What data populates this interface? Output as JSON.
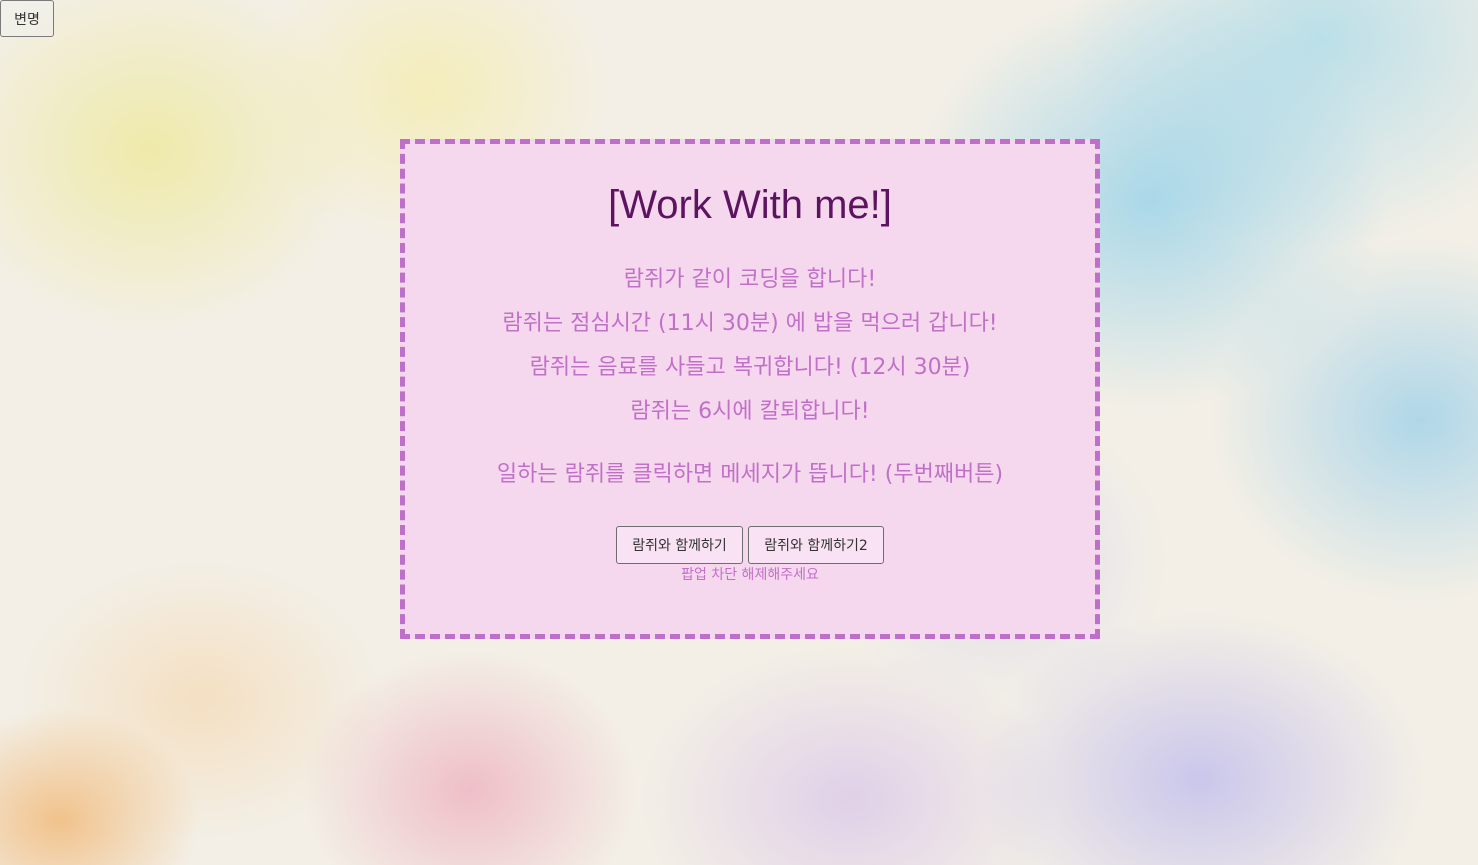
{
  "top_button": {
    "label": "변명"
  },
  "card": {
    "title": "[Work With me!]",
    "lines": [
      "람쥐가 같이 코딩을 합니다!",
      "람쥐는 점심시간 (11시 30분) 에 밥을 먹으러 갑니다!",
      "람쥐는 음료를 사들고 복귀합니다! (12시 30분)",
      "람쥐는 6시에 칼퇴합니다!"
    ],
    "note": "일하는 람쥐를 클릭하면 메세지가 뜹니다! (두번째버튼)",
    "buttons": [
      "람쥐와 함께하기",
      "람쥐와 함께하기2"
    ],
    "popup_note": "팝업 차단 해제해주세요"
  },
  "colors": {
    "card_background": "#f6d8ee",
    "card_border": "#bd6fc9",
    "title_text": "#5d1460",
    "body_text": "#c170c8"
  }
}
